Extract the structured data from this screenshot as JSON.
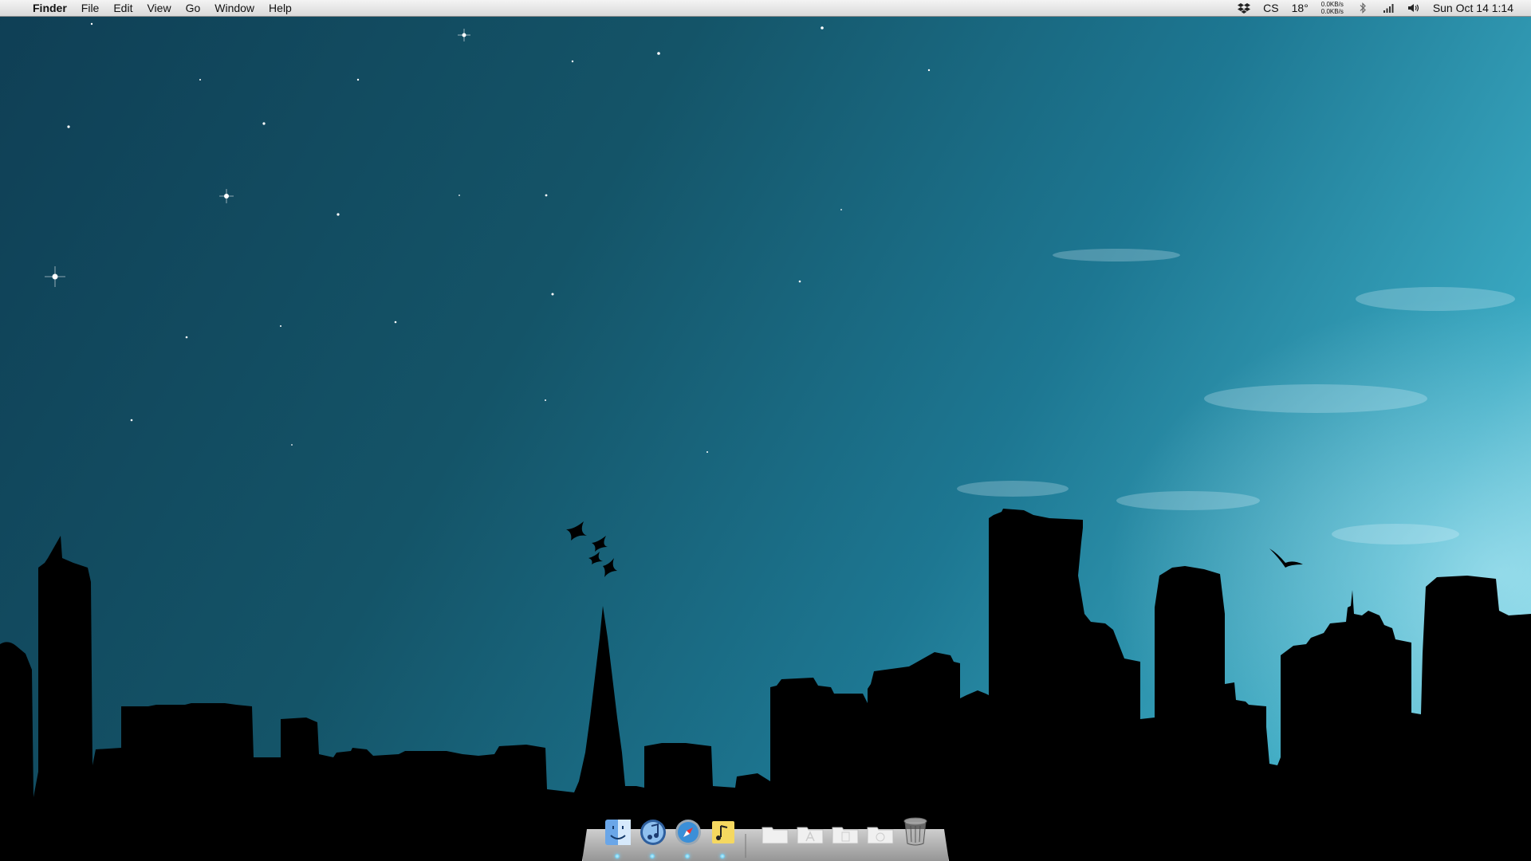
{
  "menubar": {
    "apple_glyph": "",
    "app_name": "Finder",
    "menus": [
      "File",
      "Edit",
      "View",
      "Go",
      "Window",
      "Help"
    ],
    "status": {
      "weather_label": "CS",
      "temperature": "18°",
      "net_upload": "0.0KB/s",
      "net_download": "0.0KB/s",
      "datetime": "Sun Oct 14  1:14"
    },
    "status_icons": [
      "dropbox-icon",
      "bluetooth-icon",
      "wifi-signal-icon",
      "volume-icon"
    ]
  },
  "dock": {
    "apps": [
      {
        "name": "Finder",
        "icon": "finder-icon",
        "running": true
      },
      {
        "name": "iTunes",
        "icon": "itunes-icon",
        "running": true
      },
      {
        "name": "Safari",
        "icon": "safari-icon",
        "running": true
      },
      {
        "name": "Stickies",
        "icon": "notes-music-icon",
        "running": true
      }
    ],
    "stacks": [
      {
        "icon": "folder-icon"
      },
      {
        "icon": "applications-folder-icon"
      },
      {
        "icon": "documents-folder-icon"
      },
      {
        "icon": "downloads-folder-icon"
      },
      {
        "icon": "trash-icon"
      }
    ]
  },
  "colors": {
    "sky_dark": "#0f3f55",
    "sky_light": "#7fd6e6",
    "silhouette": "#000000",
    "dock_indicator": "#4ab8e6"
  }
}
